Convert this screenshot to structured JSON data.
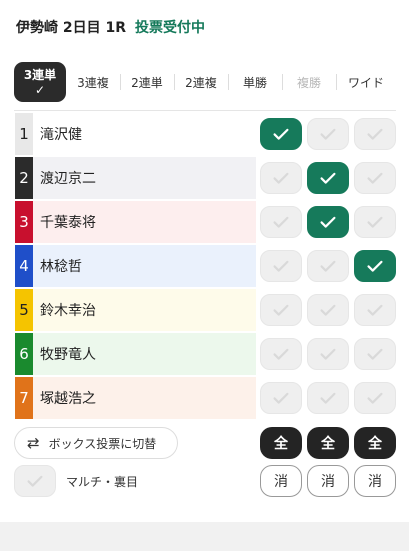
{
  "header": {
    "race": "伊勢崎 2日目 1R",
    "status": "投票受付中"
  },
  "tabs": [
    {
      "label": "3連単",
      "active": true,
      "disabled": false
    },
    {
      "label": "3連複",
      "active": false,
      "disabled": false
    },
    {
      "label": "2連単",
      "active": false,
      "disabled": false
    },
    {
      "label": "2連複",
      "active": false,
      "disabled": false
    },
    {
      "label": "単勝",
      "active": false,
      "disabled": false
    },
    {
      "label": "複勝",
      "active": false,
      "disabled": true
    },
    {
      "label": "ワイド",
      "active": false,
      "disabled": false
    }
  ],
  "active_check_glyph": "✓",
  "racers": [
    {
      "num": "1",
      "name": "滝沢健",
      "num_bg": "#e8e8e8",
      "num_fg": "#222222",
      "row_bg": "#ffffff",
      "checked": [
        true,
        false,
        false
      ]
    },
    {
      "num": "2",
      "name": "渡辺京二",
      "num_bg": "#2b2b2b",
      "num_fg": "#ffffff",
      "row_bg": "#f1f1f4",
      "checked": [
        false,
        true,
        false
      ]
    },
    {
      "num": "3",
      "name": "千葉泰将",
      "num_bg": "#c8102e",
      "num_fg": "#ffffff",
      "row_bg": "#fdeeee",
      "checked": [
        false,
        true,
        false
      ]
    },
    {
      "num": "4",
      "name": "林稔哲",
      "num_bg": "#1f4fc9",
      "num_fg": "#ffffff",
      "row_bg": "#eaf1fc",
      "checked": [
        false,
        false,
        true
      ]
    },
    {
      "num": "5",
      "name": "鈴木幸治",
      "num_bg": "#f5c400",
      "num_fg": "#222222",
      "row_bg": "#fefbea",
      "checked": [
        false,
        false,
        false
      ]
    },
    {
      "num": "6",
      "name": "牧野竜人",
      "num_bg": "#1a8a2e",
      "num_fg": "#ffffff",
      "row_bg": "#ecf8ec",
      "checked": [
        false,
        false,
        false
      ]
    },
    {
      "num": "7",
      "name": "塚越浩之",
      "num_bg": "#e0731a",
      "num_fg": "#ffffff",
      "row_bg": "#fdf1ea",
      "checked": [
        false,
        false,
        false
      ]
    }
  ],
  "controls": {
    "box_switch_label": "ボックス投票に切替",
    "swap_icon": "⇄",
    "multi_label": "マルチ・裏目",
    "multi_checked": false,
    "all_label": "全",
    "clear_label": "消"
  },
  "colors": {
    "accent": "#167a5b",
    "status": "#14795a"
  }
}
